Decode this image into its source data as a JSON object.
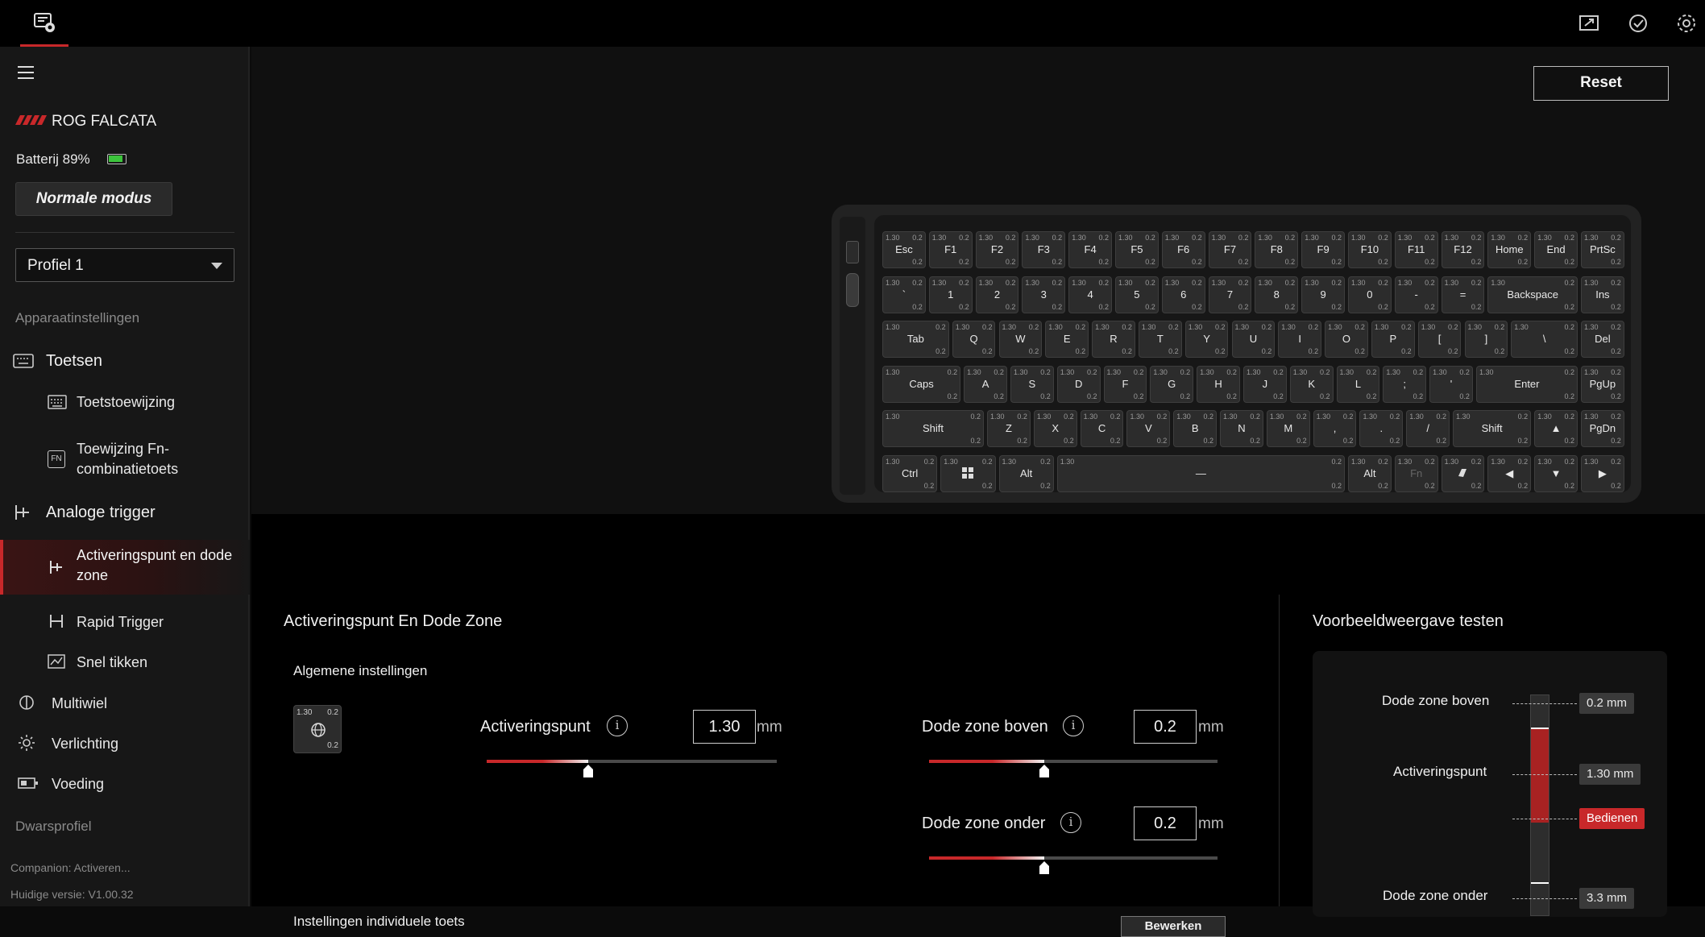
{
  "topbar": {
    "app_icon": "armoury-icon",
    "right_icons": [
      "screen-sync-icon",
      "check-update-icon",
      "gear-icon"
    ]
  },
  "sidebar": {
    "device_name": "ROG FALCATA",
    "battery": "Batterij 89%",
    "mode_button": "Normale modus",
    "profile": "Profiel 1",
    "section_device": "Apparaatinstellingen",
    "toetsen": "Toetsen",
    "toetstoewijzing": "Toetstoewijzing",
    "fn_line1": "Toewijzing Fn-",
    "fn_line2": "combinatietoets",
    "analoge": "Analoge trigger",
    "activering_line1": "Activeringspunt en dode",
    "activering_line2": "zone",
    "rapid": "Rapid Trigger",
    "snel": "Snel tikken",
    "multiwiel": "Multiwiel",
    "verlichting": "Verlichting",
    "voeding": "Voeding",
    "dwarsprofiel": "Dwarsprofiel",
    "companion": "Companion: Activeren...",
    "version": "Huidige versie: V1.00.32"
  },
  "main": {
    "reset": "Reset",
    "section_title": "Activeringspunt En Dode Zone",
    "general": "Algemene instellingen",
    "global_key": {
      "a": "1.30",
      "b": "0.2",
      "c": "0.2"
    },
    "activeringspunt": {
      "label": "Activeringspunt",
      "value": "1.30",
      "unit": "mm",
      "level": 0.35
    },
    "dode_boven": {
      "label": "Dode zone boven",
      "value": "0.2",
      "unit": "mm",
      "level": 0.4
    },
    "dode_onder": {
      "label": "Dode zone onder",
      "value": "0.2",
      "unit": "mm",
      "level": 0.4
    },
    "individual": "Instellingen individuele toets",
    "edit": "Bewerken",
    "preview_title": "Voorbeeldweergave testen",
    "preview": {
      "labels": [
        "Dode zone boven",
        "Activeringspunt",
        "Dode zone onder"
      ],
      "tag_top": "0.2 mm",
      "tag_act": "1.30 mm",
      "tag_operate": "Bedienen",
      "tag_bottom": "3.3 mm"
    }
  },
  "keyboard": {
    "rows": [
      [
        "Esc",
        "F1",
        "F2",
        "F3",
        "F4",
        "F5",
        "F6",
        "F7",
        "F8",
        "F9",
        "F10",
        "F11",
        "F12",
        "Home",
        "End",
        "PrtSc"
      ],
      [
        "`",
        "1",
        "2",
        "3",
        "4",
        "5",
        "6",
        "7",
        "8",
        "9",
        "0",
        "-",
        "=",
        "Backspace",
        "Ins"
      ],
      [
        "Tab",
        "Q",
        "W",
        "E",
        "R",
        "T",
        "Y",
        "U",
        "I",
        "O",
        "P",
        "[",
        "]",
        "\\",
        "Del"
      ],
      [
        "Caps",
        "A",
        "S",
        "D",
        "F",
        "G",
        "H",
        "J",
        "K",
        "L",
        ";",
        "'",
        "Enter",
        "PgUp"
      ],
      [
        "Shift",
        "Z",
        "X",
        "C",
        "V",
        "B",
        "N",
        "M",
        ",",
        ".",
        "/",
        "Shift",
        "▲",
        "PgDn"
      ],
      [
        "Ctrl",
        "windows-icon",
        "Alt",
        "—",
        "Alt",
        "Fn",
        "copilot-icon",
        "◀",
        "▼",
        "▶"
      ]
    ],
    "key_a": "1.30",
    "key_b": "0.2"
  }
}
